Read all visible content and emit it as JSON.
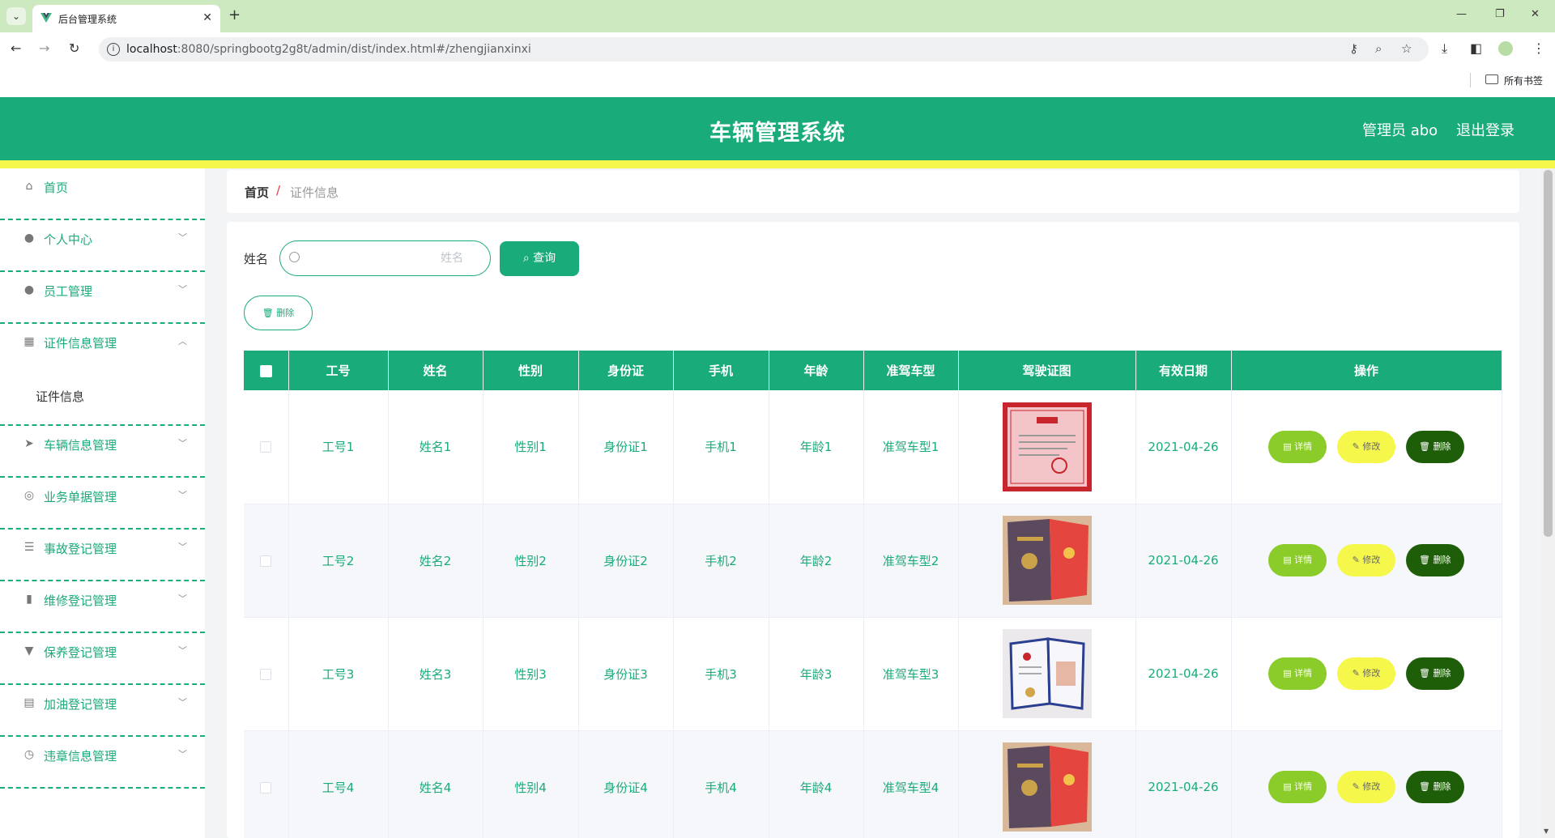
{
  "browser": {
    "tab_title": "后台管理系统",
    "url_host": "localhost",
    "url_path": ":8080/springbootg2g8t/admin/dist/index.html#/zhengjianxinxi",
    "bookmarks_label": "所有书签"
  },
  "header": {
    "title": "车辆管理系统",
    "user": "管理员 abo",
    "logout": "退出登录"
  },
  "sidebar": {
    "items": [
      {
        "label": "首页",
        "icon": "home-icon"
      },
      {
        "label": "个人中心",
        "icon": "user-icon"
      },
      {
        "label": "员工管理",
        "icon": "user-icon"
      },
      {
        "label": "证件信息管理",
        "icon": "grid-icon"
      },
      {
        "label": "车辆信息管理",
        "icon": "send-icon"
      },
      {
        "label": "业务单据管理",
        "icon": "lifebuoy-icon"
      },
      {
        "label": "事故登记管理",
        "icon": "list-icon"
      },
      {
        "label": "维修登记管理",
        "icon": "bar-chart-icon"
      },
      {
        "label": "保养登记管理",
        "icon": "paint-icon"
      },
      {
        "label": "加油登记管理",
        "icon": "film-icon"
      },
      {
        "label": "违章信息管理",
        "icon": "compass-icon"
      }
    ],
    "sub_item": "证件信息"
  },
  "breadcrumb": {
    "home": "首页",
    "separator": "/",
    "current": "证件信息"
  },
  "search": {
    "label": "姓名",
    "placeholder": "姓名",
    "query_button": "查询",
    "delete_button": "删除"
  },
  "table": {
    "columns": [
      "工号",
      "姓名",
      "性别",
      "身份证",
      "手机",
      "年龄",
      "准驾车型",
      "驾驶证图",
      "有效日期",
      "操作"
    ],
    "rows": [
      {
        "id": "工号1",
        "name": "姓名1",
        "gender": "性别1",
        "idcard": "身份证1",
        "phone": "手机1",
        "age": "年龄1",
        "license": "准驾车型1",
        "date": "2021-04-26"
      },
      {
        "id": "工号2",
        "name": "姓名2",
        "gender": "性别2",
        "idcard": "身份证2",
        "phone": "手机2",
        "age": "年龄2",
        "license": "准驾车型2",
        "date": "2021-04-26"
      },
      {
        "id": "工号3",
        "name": "姓名3",
        "gender": "性别3",
        "idcard": "身份证3",
        "phone": "手机3",
        "age": "年龄3",
        "license": "准驾车型3",
        "date": "2021-04-26"
      },
      {
        "id": "工号4",
        "name": "姓名4",
        "gender": "性别4",
        "idcard": "身份证4",
        "phone": "手机4",
        "age": "年龄4",
        "license": "准驾车型4",
        "date": "2021-04-26"
      }
    ],
    "actions": {
      "detail": "详情",
      "edit": "修改",
      "delete": "删除"
    }
  },
  "colors": {
    "primary": "#1aab7a",
    "accent_yellow": "#f5f84a",
    "detail_green": "#8bcb2a",
    "delete_dark": "#1f5e08"
  }
}
